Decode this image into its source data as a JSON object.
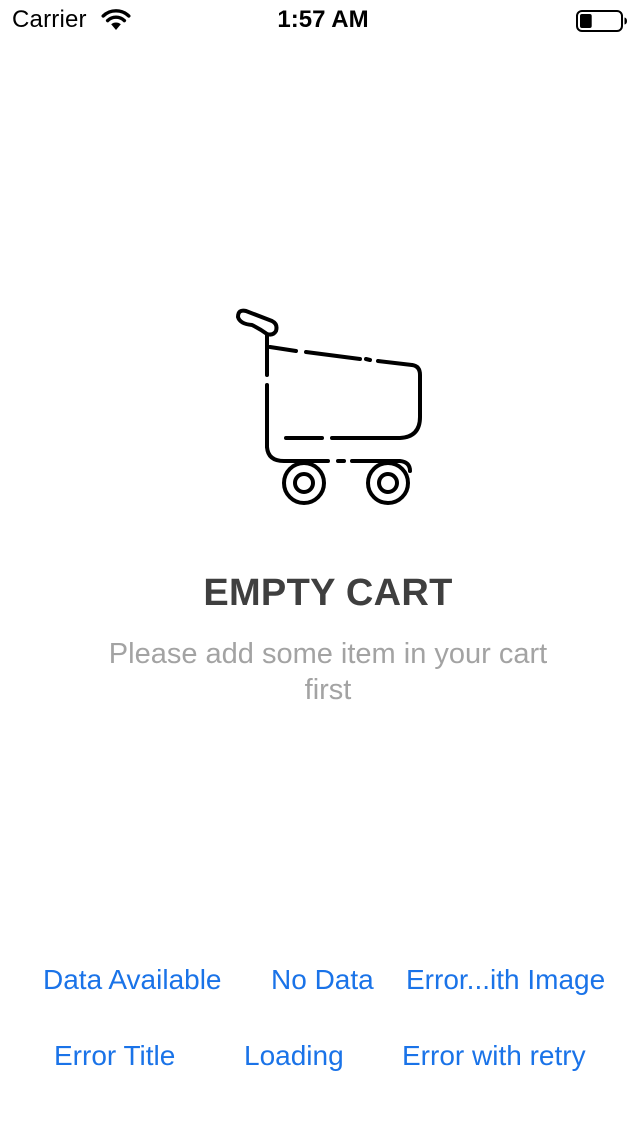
{
  "status_bar": {
    "carrier": "Carrier",
    "time": "1:57 AM",
    "battery_level": 0.3,
    "wifi_icon": "wifi-icon",
    "battery_icon": "battery-icon"
  },
  "empty_state": {
    "icon": "shopping-cart-icon",
    "title": "EMPTY CART",
    "message": "Please add some item in your cart first"
  },
  "state_buttons": {
    "data_available": "Data Available",
    "no_data": "No Data",
    "error_with_image": "Error...ith Image",
    "error_title": "Error Title",
    "loading": "Loading",
    "error_with_retry": "Error with retry"
  },
  "colors": {
    "accent": "#1a73e8",
    "title": "#3f3f3f",
    "subtitle": "#a3a3a3",
    "background": "#ffffff"
  }
}
